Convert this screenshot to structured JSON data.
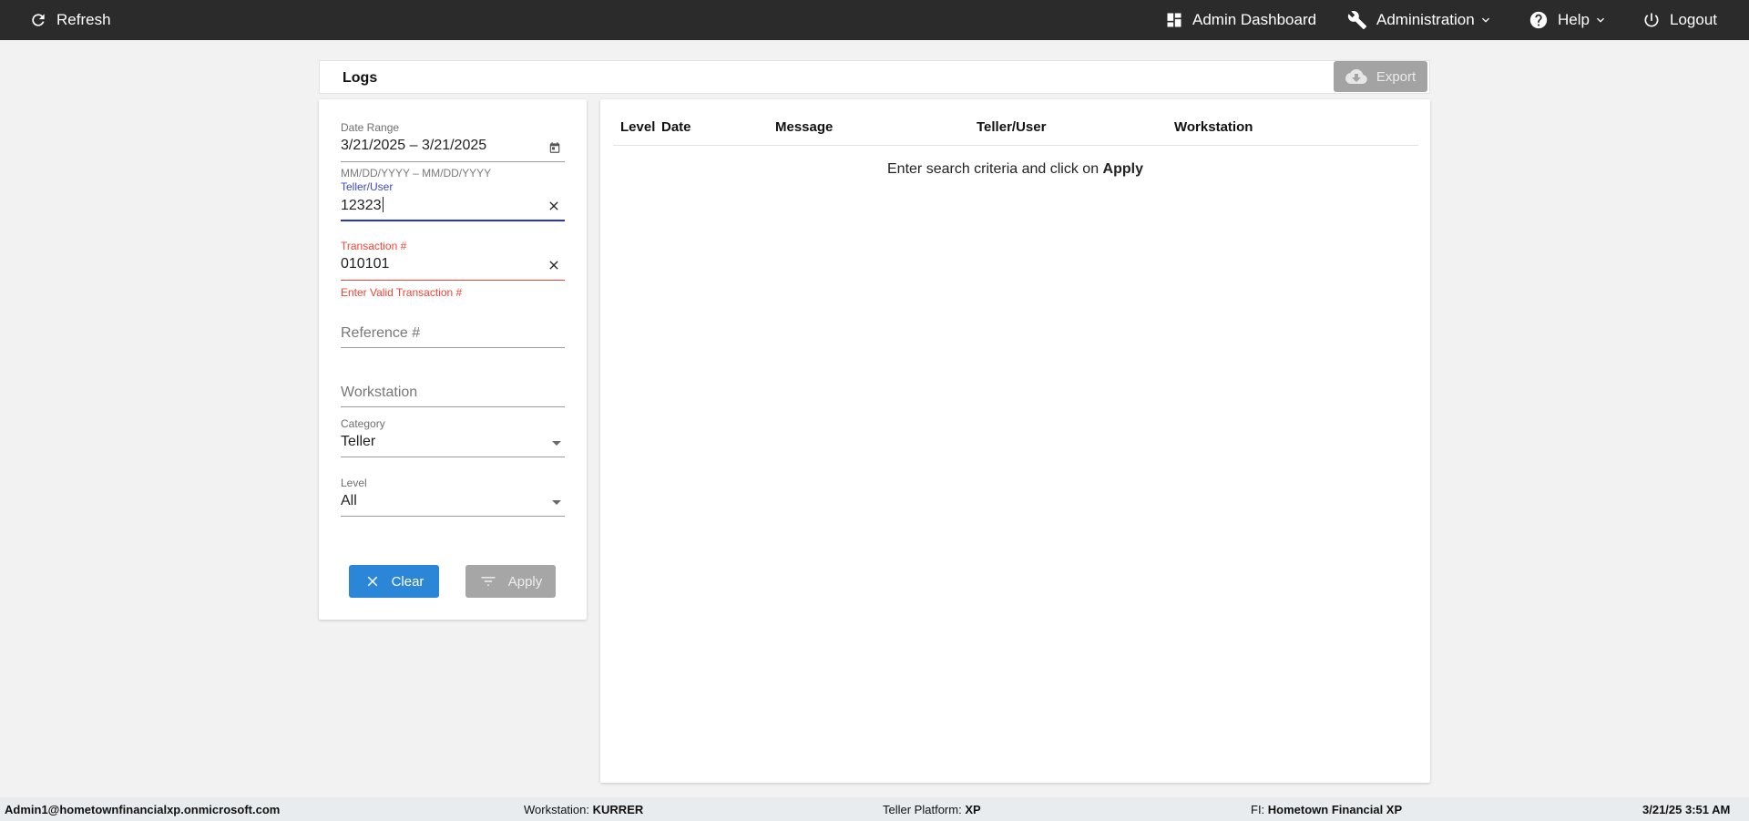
{
  "topbar": {
    "refresh_label": "Refresh",
    "admin_dashboard_label": "Admin Dashboard",
    "administration_label": "Administration",
    "help_label": "Help",
    "logout_label": "Logout"
  },
  "header": {
    "title": "Logs",
    "export_label": "Export"
  },
  "filters": {
    "date_range": {
      "label": "Date Range",
      "value": "3/21/2025 – 3/21/2025",
      "hint": "MM/DD/YYYY – MM/DD/YYYY"
    },
    "teller_user": {
      "label": "Teller/User",
      "value": "12323"
    },
    "transaction": {
      "label": "Transaction #",
      "value": "010101",
      "error": "Enter Valid Transaction #"
    },
    "reference": {
      "placeholder": "Reference #"
    },
    "workstation": {
      "placeholder": "Workstation"
    },
    "category": {
      "label": "Category",
      "value": "Teller"
    },
    "level": {
      "label": "Level",
      "value": "All"
    },
    "clear_label": "Clear",
    "apply_label": "Apply"
  },
  "results": {
    "columns": [
      "Level",
      "Date",
      "Message",
      "Teller/User",
      "Workstation"
    ],
    "empty_prefix": "Enter search criteria and click on ",
    "empty_action": "Apply"
  },
  "statusbar": {
    "user": "Admin1@hometownfinancialxp.onmicrosoft.com",
    "workstation_label": "Workstation:",
    "workstation_value": "KURRER",
    "platform_label": "Teller Platform:",
    "platform_value": "XP",
    "fi_label": "FI:",
    "fi_value": "Hometown Financial XP",
    "datetime": "3/21/25 3:51 AM"
  },
  "colors": {
    "topbar_bg": "#2b2b2b",
    "accent_blue": "#2c86d8",
    "focus_blue": "#2732c8",
    "error_red": "#f44336",
    "disabled_gray": "#a6a6a6"
  }
}
